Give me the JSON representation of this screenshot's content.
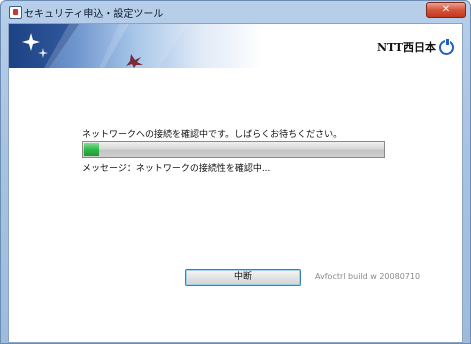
{
  "window": {
    "title": "セキュリティ申込・設定ツール",
    "close_glyph": "✕"
  },
  "banner": {
    "brand": "NTT西日本",
    "brand_icon": "ntt-logo-icon"
  },
  "main": {
    "status_text": "ネットワークへの接続を確認中です。しばらくお待ちください。",
    "progress_fraction": 0.05,
    "message": "メッセージ：ネットワークの接続性を確認中..."
  },
  "footer": {
    "cancel_label": "中断",
    "build_text": "Avfoctrl build w 20080710"
  },
  "colors": {
    "progress_fill": "#2fb84a",
    "banner_dark": "#234a8f",
    "brand_blue": "#1b5fc7"
  }
}
